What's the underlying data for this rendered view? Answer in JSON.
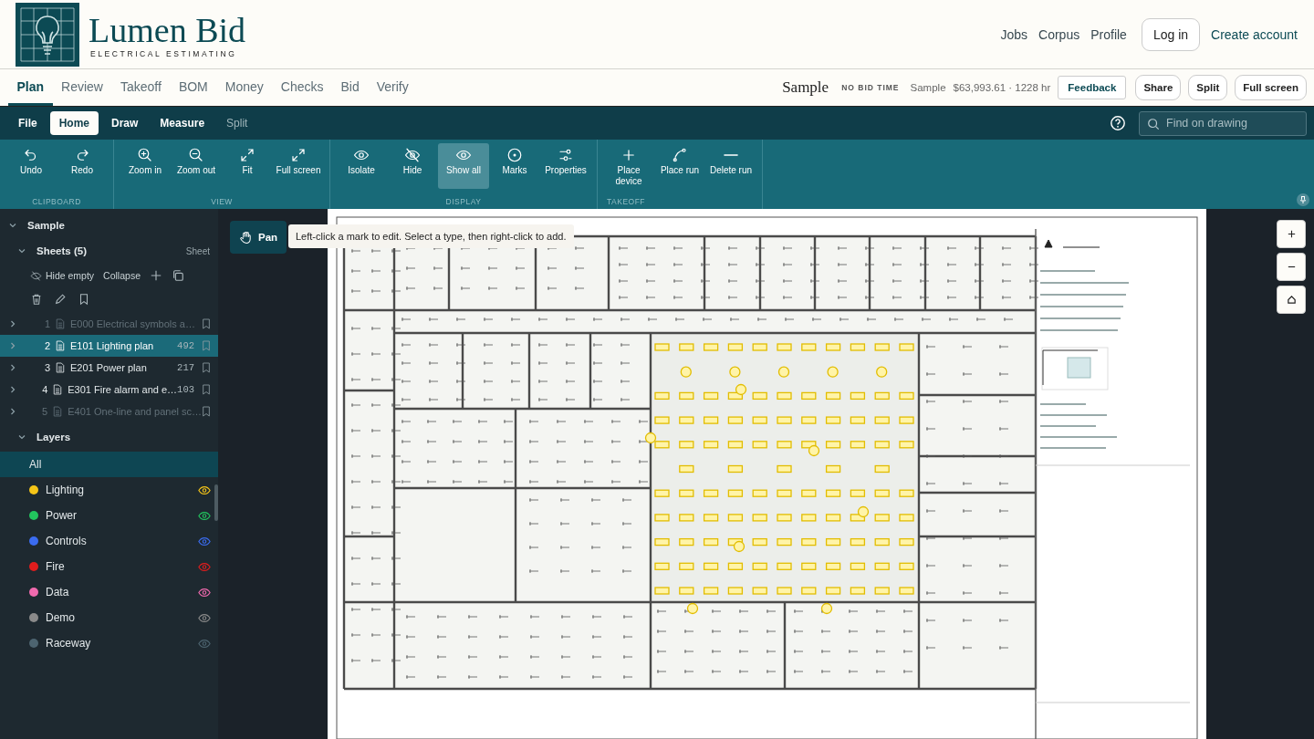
{
  "brand": {
    "name": "Lumen Bid",
    "tagline": "ELECTRICAL ESTIMATING"
  },
  "top_links": [
    "Jobs",
    "Corpus",
    "Profile"
  ],
  "login": "Log in",
  "create_account": "Create account",
  "nav_tabs": [
    {
      "label": "Plan",
      "selected": true
    },
    {
      "label": "Review",
      "selected": false
    },
    {
      "label": "Takeoff",
      "selected": false
    },
    {
      "label": "BOM",
      "selected": false
    },
    {
      "label": "Money",
      "selected": false
    },
    {
      "label": "Checks",
      "selected": false
    },
    {
      "label": "Bid",
      "selected": false
    },
    {
      "label": "Verify",
      "selected": false
    }
  ],
  "project": {
    "title": "Sample",
    "bid_time": "NO BID TIME",
    "name": "Sample",
    "total": "$63,993.61 · 1228 hr"
  },
  "header_buttons": [
    {
      "label": "Feedback",
      "kind": "outline"
    },
    {
      "label": "Share",
      "kind": "pill"
    },
    {
      "label": "Split",
      "kind": "pill"
    },
    {
      "label": "Full screen",
      "kind": "pill"
    }
  ],
  "ribbon_tabs": [
    {
      "label": "File",
      "selected": false,
      "disabled": false
    },
    {
      "label": "Home",
      "selected": true,
      "disabled": false
    },
    {
      "label": "Draw",
      "selected": false,
      "disabled": false
    },
    {
      "label": "Measure",
      "selected": false,
      "disabled": false
    },
    {
      "label": "Split",
      "selected": false,
      "disabled": true
    }
  ],
  "search": {
    "placeholder": "Find on drawing"
  },
  "ribbon_groups": [
    {
      "label": "CLIPBOARD",
      "tools": [
        {
          "label": "Undo",
          "active": false
        },
        {
          "label": "Redo",
          "active": false
        }
      ]
    },
    {
      "label": "VIEW",
      "tools": [
        {
          "label": "Zoom in",
          "active": false
        },
        {
          "label": "Zoom out",
          "active": false
        },
        {
          "label": "Fit",
          "active": false
        },
        {
          "label": "Full screen",
          "active": false
        }
      ]
    },
    {
      "label": "DISPLAY",
      "tools": [
        {
          "label": "Isolate",
          "active": false
        },
        {
          "label": "Hide",
          "active": false
        },
        {
          "label": "Show all",
          "active": true
        },
        {
          "label": "Marks",
          "active": false
        },
        {
          "label": "Properties",
          "active": false
        }
      ]
    },
    {
      "label": "TAKEOFF",
      "tools": [
        {
          "label": "Place device",
          "active": false
        },
        {
          "label": "Place run",
          "active": false
        },
        {
          "label": "Delete run",
          "active": false
        }
      ]
    }
  ],
  "tree": {
    "label": "Sample",
    "expanded": true
  },
  "sheets": {
    "label": "Sheets (5)",
    "expanded": true,
    "column": "Sheet",
    "actions": [
      "Hide empty",
      "Collapse"
    ],
    "items": [
      {
        "number": "1",
        "name": "E000 Electrical symbols a…",
        "expanded": false,
        "selected": false,
        "disabled": true
      },
      {
        "number": "2",
        "name": "E101 Lighting plan",
        "count": "492",
        "expanded": false,
        "selected": true,
        "disabled": false
      },
      {
        "number": "3",
        "name": "E201 Power plan",
        "count": "217",
        "expanded": false,
        "selected": false,
        "disabled": false
      },
      {
        "number": "4",
        "name": "E301 Fire alarm and e…",
        "count": "103",
        "expanded": false,
        "selected": false,
        "disabled": false
      },
      {
        "number": "5",
        "name": "E401 One-line and panel sc…",
        "expanded": false,
        "selected": false,
        "disabled": true
      }
    ]
  },
  "layers": {
    "label": "Layers",
    "expanded": true,
    "items": [
      {
        "name": "All",
        "kind": "all",
        "selected": true
      },
      {
        "name": "Lighting",
        "kind": "layer",
        "color": "#f5c518",
        "selected": false
      },
      {
        "name": "Power",
        "kind": "layer",
        "color": "#22c55e",
        "selected": false
      },
      {
        "name": "Controls",
        "kind": "layer",
        "color": "#3b6cf0",
        "selected": false
      },
      {
        "name": "Fire",
        "kind": "layer",
        "color": "#e11d1d",
        "selected": false
      },
      {
        "name": "Data",
        "kind": "layer",
        "color": "#f06aae",
        "selected": false
      },
      {
        "name": "Demo",
        "kind": "layer",
        "color": "#8a8a8a",
        "selected": false
      },
      {
        "name": "Raceway",
        "kind": "layer",
        "color": "#4d6470",
        "selected": false
      }
    ]
  },
  "canvas": {
    "tool": {
      "label": "Pan",
      "selected": true
    },
    "hint": "Left-click a mark to edit. Select a type, then right-click to add."
  }
}
